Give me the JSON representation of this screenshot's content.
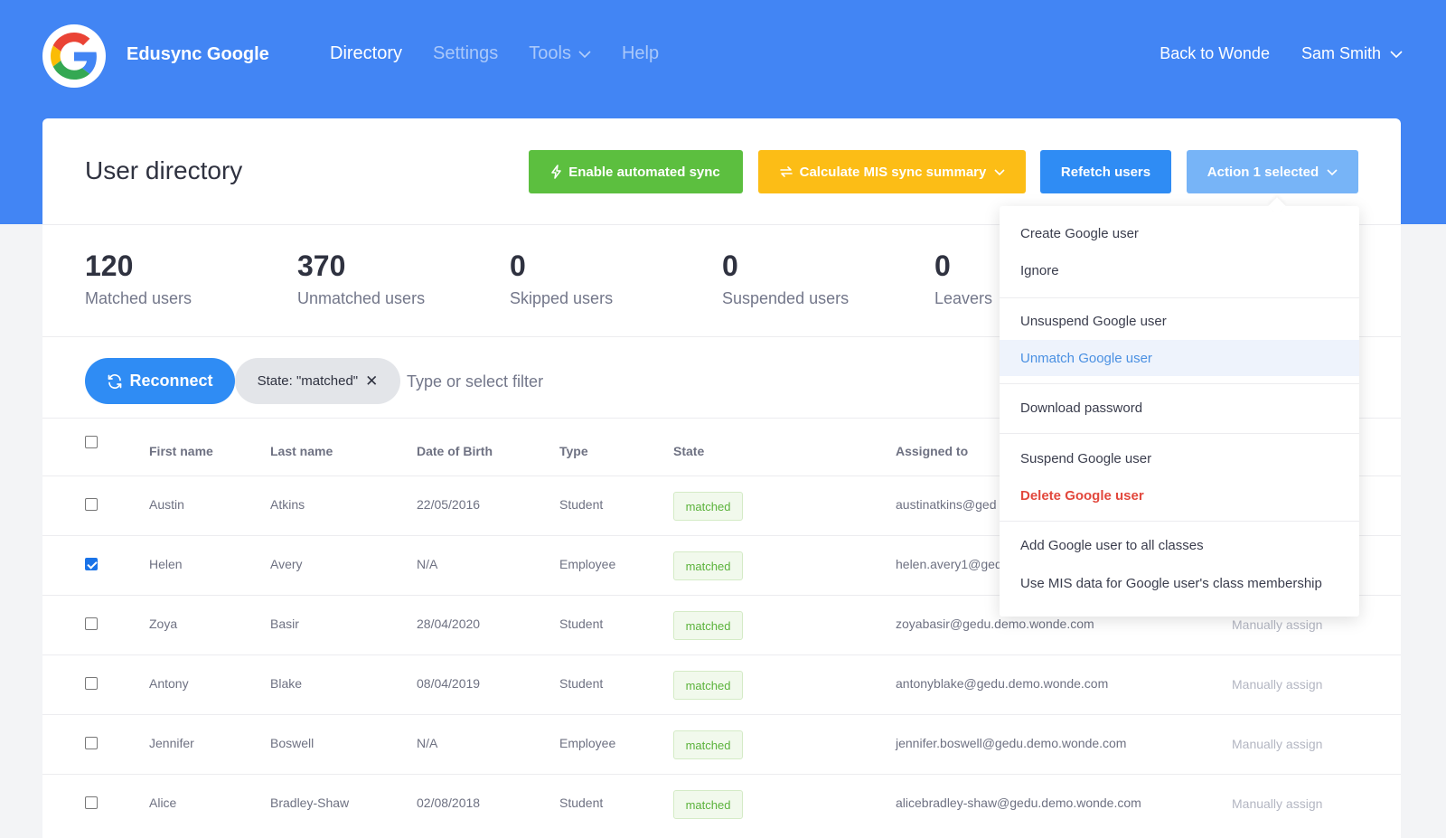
{
  "header": {
    "brand": "Edusync Google",
    "nav": [
      "Directory",
      "Settings",
      "Tools",
      "Help"
    ],
    "back_link": "Back to Wonde",
    "user_name": "Sam Smith"
  },
  "toolbar": {
    "title": "User directory",
    "enable_sync": "Enable automated sync",
    "calculate": "Calculate MIS sync summary",
    "refetch": "Refetch users",
    "action": "Action 1 selected"
  },
  "stats": [
    {
      "value": "120",
      "label": "Matched users"
    },
    {
      "value": "370",
      "label": "Unmatched users"
    },
    {
      "value": "0",
      "label": "Skipped users"
    },
    {
      "value": "0",
      "label": "Suspended users"
    },
    {
      "value": "0",
      "label": "Leavers"
    }
  ],
  "filter": {
    "reconnect": "Reconnect",
    "chip": "State: \"matched\"",
    "placeholder": "Type or select filter"
  },
  "table": {
    "headers": [
      "First name",
      "Last name",
      "Date of Birth",
      "Type",
      "State",
      "Assigned to"
    ],
    "rows": [
      {
        "first": "Austin",
        "last": "Atkins",
        "dob": "22/05/2016",
        "type": "Student",
        "state": "matched",
        "email": "austinatkins@ged",
        "action": "",
        "checked": false
      },
      {
        "first": "Helen",
        "last": "Avery",
        "dob": "N/A",
        "type": "Employee",
        "state": "matched",
        "email": "helen.avery1@ged",
        "action": "",
        "checked": true
      },
      {
        "first": "Zoya",
        "last": "Basir",
        "dob": "28/04/2020",
        "type": "Student",
        "state": "matched",
        "email": "zoyabasir@gedu.demo.wonde.com",
        "action": "Manually assign",
        "checked": false
      },
      {
        "first": "Antony",
        "last": "Blake",
        "dob": "08/04/2019",
        "type": "Student",
        "state": "matched",
        "email": "antonyblake@gedu.demo.wonde.com",
        "action": "Manually assign",
        "checked": false
      },
      {
        "first": "Jennifer",
        "last": "Boswell",
        "dob": "N/A",
        "type": "Employee",
        "state": "matched",
        "email": "jennifer.boswell@gedu.demo.wonde.com",
        "action": "Manually assign",
        "checked": false
      },
      {
        "first": "Alice",
        "last": "Bradley-Shaw",
        "dob": "02/08/2018",
        "type": "Student",
        "state": "matched",
        "email": "alicebradley-shaw@gedu.demo.wonde.com",
        "action": "Manually assign",
        "checked": false
      }
    ]
  },
  "dropdown": {
    "items": [
      "Create Google user",
      "Ignore",
      "Unsuspend Google user",
      "Unmatch Google user",
      "Download password",
      "Suspend Google user",
      "Delete Google user",
      "Add Google user to all classes",
      "Use MIS data for Google user's class membership"
    ]
  },
  "colors": {
    "header_blue": "#4285f4",
    "green": "#5cbf3f",
    "yellow": "#fcbd16",
    "blue": "#2f8cf4",
    "light_blue": "#77b4f7",
    "danger": "#e2483d"
  }
}
